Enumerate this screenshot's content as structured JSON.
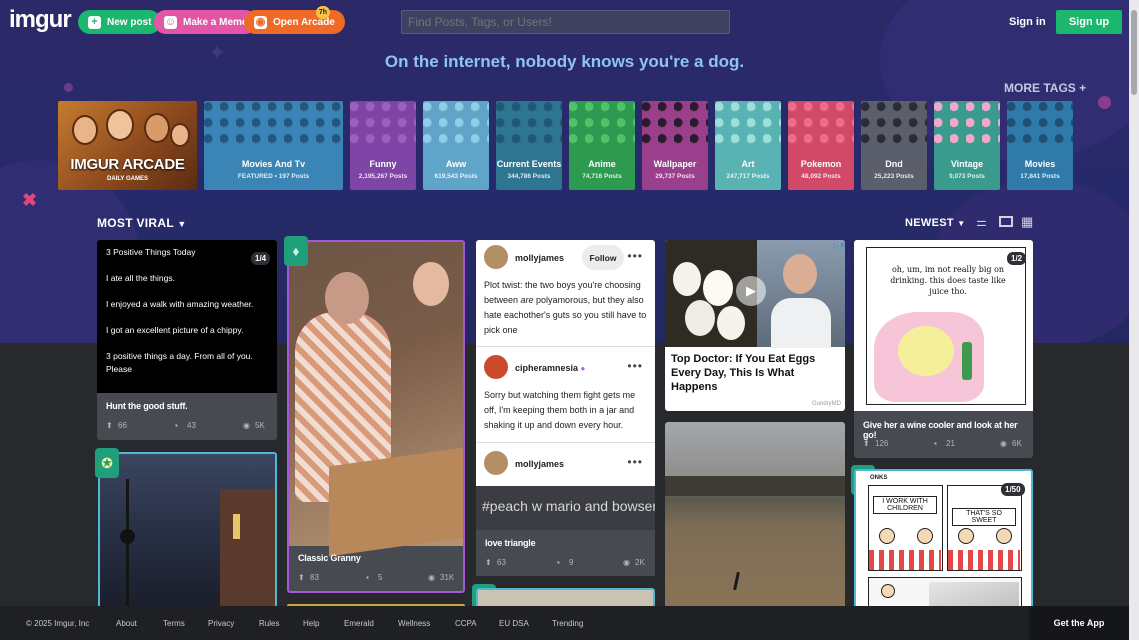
{
  "header": {
    "logo": "imgur",
    "new_post": "New post",
    "make_meme": "Make a Meme",
    "open_arcade": "Open Arcade",
    "arcade_badge": "7h",
    "search_placeholder": "Find Posts, Tags, or Users!",
    "sign_in": "Sign in",
    "sign_up": "Sign up"
  },
  "tagline": "On the internet, nobody knows you're a dog.",
  "more_tags": "MORE TAGS +",
  "arcade": {
    "title": "IMGUR ARCADE",
    "subtitle": "DAILY GAMES"
  },
  "tags": [
    {
      "name": "Movies And Tv",
      "count": "FEATURED • 197 Posts",
      "color": "#3a84b6",
      "pattern": "#24567f"
    },
    {
      "name": "Funny",
      "count": "2,195,267 Posts",
      "color": "#7f45a6",
      "pattern": "#9b61c0"
    },
    {
      "name": "Aww",
      "count": "619,543 Posts",
      "color": "#5fa5c9",
      "pattern": "#8fcde8"
    },
    {
      "name": "Current Events",
      "count": "344,786 Posts",
      "color": "#2d7591",
      "pattern": "#1f5a73"
    },
    {
      "name": "Anime",
      "count": "74,716 Posts",
      "color": "#2e9a4f",
      "pattern": "#4fc56a"
    },
    {
      "name": "Wallpaper",
      "count": "29,737 Posts",
      "color": "#9a3f8c",
      "pattern": "#2b1a2d"
    },
    {
      "name": "Art",
      "count": "247,717 Posts",
      "color": "#5ab3b3",
      "pattern": "#9fe0dc"
    },
    {
      "name": "Pokemon",
      "count": "48,092 Posts",
      "color": "#d04a68",
      "pattern": "#ef6d8c"
    },
    {
      "name": "Dnd",
      "count": "25,223 Posts",
      "color": "#5b5f6b",
      "pattern": "#2c2e34"
    },
    {
      "name": "Vintage",
      "count": "9,073 Posts",
      "color": "#3a9a8e",
      "pattern": "#f1a9c9"
    },
    {
      "name": "Movies",
      "count": "17,841 Posts",
      "color": "#2f7aa8",
      "pattern": "#1f4f73"
    }
  ],
  "feed": {
    "most_viral": "MOST VIRAL",
    "newest": "NEWEST"
  },
  "card1": {
    "lines": [
      "3 Positive Things Today",
      "I ate all the things.",
      "I enjoyed a walk with amazing weather.",
      "I got an excellent picture of a chippy.",
      "3 positive things a day. From all of you. Please"
    ],
    "page": "1/4",
    "title": "Hunt the good stuff.",
    "upvotes": "66",
    "comments": "43",
    "views": "5K"
  },
  "card2": {
    "title": "Classic Granny",
    "upvotes": "83",
    "comments": "5",
    "views": "31K"
  },
  "post1": {
    "user": "mollyjames",
    "follow": "Follow",
    "text_before": "Plot twist: the two boys you're choosing between ",
    "text_em": "are",
    "text_after": " polyamorous, but they also hate eachother's guts so you still have to pick one"
  },
  "post2": {
    "user": "cipheramnesia",
    "text": "Sorry but watching them fight gets me off, I'm keeping them both in a jar and shaking it up and down every hour."
  },
  "post3": {
    "user": "mollyjames",
    "image_text": "#peach w mario and bowser",
    "title": "love triangle",
    "upvotes": "63",
    "comments": "9",
    "views": "2K"
  },
  "ad": {
    "headline": "Top Doctor: If You Eat Eggs Every Day, This Is What Happens",
    "source": "GundryMD"
  },
  "card4": {
    "comic_text": "oh, um, im not really big on drinking. this does taste like juice tho.",
    "page": "1/2",
    "title": "Give her a wine cooler and look at her go!",
    "upvotes": "126",
    "comments": "21",
    "views": "6K"
  },
  "card5": {
    "page": "1/50",
    "panel1": "I WORK WITH CHILDREN",
    "panel2": "THAT'S SO SWEET",
    "label": "ONKS"
  },
  "footer": {
    "copyright": "© 2025 Imgur, Inc",
    "links": [
      "About",
      "Terms",
      "Privacy",
      "Rules",
      "Help",
      "Emerald",
      "Wellness",
      "CCPA",
      "EU DSA",
      "Trending"
    ],
    "get_app": "Get the App"
  },
  "colors": {
    "hero": "#2a2967",
    "signup": "#1bb76e",
    "new_post": "#1bb76e",
    "meme": "#e356a7",
    "arcade": "#f06a27",
    "tagline": "#8fc3f6"
  }
}
